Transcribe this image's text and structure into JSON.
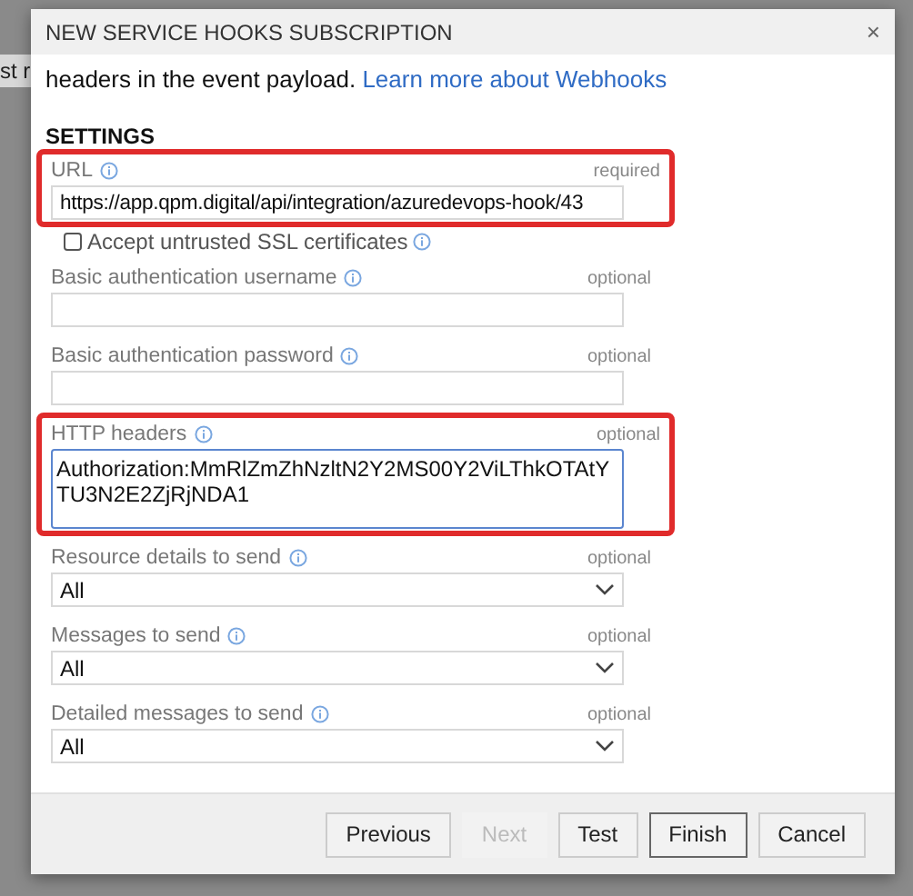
{
  "background_text": "st r",
  "dialog": {
    "title": "NEW SERVICE HOOKS SUBSCRIPTION",
    "close": "×",
    "intro": {
      "text": "headers in the event payload.",
      "link": "Learn more about Webhooks"
    },
    "section": "SETTINGS",
    "fields": [
      {
        "kind": "text",
        "label": "URL",
        "hint": "required",
        "value": "https://app.qpm.digital/api/integration/azuredevops-hook/43",
        "highlighted": true
      },
      {
        "kind": "checkbox",
        "label": "Accept untrusted SSL certificates",
        "checked": false
      },
      {
        "kind": "text",
        "label": "Basic authentication username",
        "hint": "optional",
        "highlighted": false
      },
      {
        "kind": "text",
        "label": "Basic authentication password",
        "hint": "optional",
        "highlighted": false
      },
      {
        "kind": "textarea",
        "label": "HTTP headers",
        "hint": "optional",
        "value": "Authorization:MmRlZmZhNzltN2Y2MS00Y2ViLThkOTAtYTU3N2E2ZjRjNDA1",
        "highlighted": true
      },
      {
        "kind": "select",
        "label": "Resource details to send",
        "hint": "optional",
        "value": "All",
        "highlighted": false
      },
      {
        "kind": "select",
        "label": "Messages to send",
        "hint": "optional",
        "value": "All",
        "highlighted": false
      },
      {
        "kind": "select",
        "label": "Detailed messages to send",
        "hint": "optional",
        "value": "All",
        "highlighted": false
      }
    ],
    "buttons": [
      {
        "label": "Previous",
        "disabled": false,
        "focused": false
      },
      {
        "label": "Next",
        "disabled": true,
        "focused": false
      },
      {
        "label": "Test",
        "disabled": false,
        "focused": false
      },
      {
        "label": "Finish",
        "disabled": false,
        "focused": true
      },
      {
        "label": "Cancel",
        "disabled": false,
        "focused": false
      }
    ]
  }
}
